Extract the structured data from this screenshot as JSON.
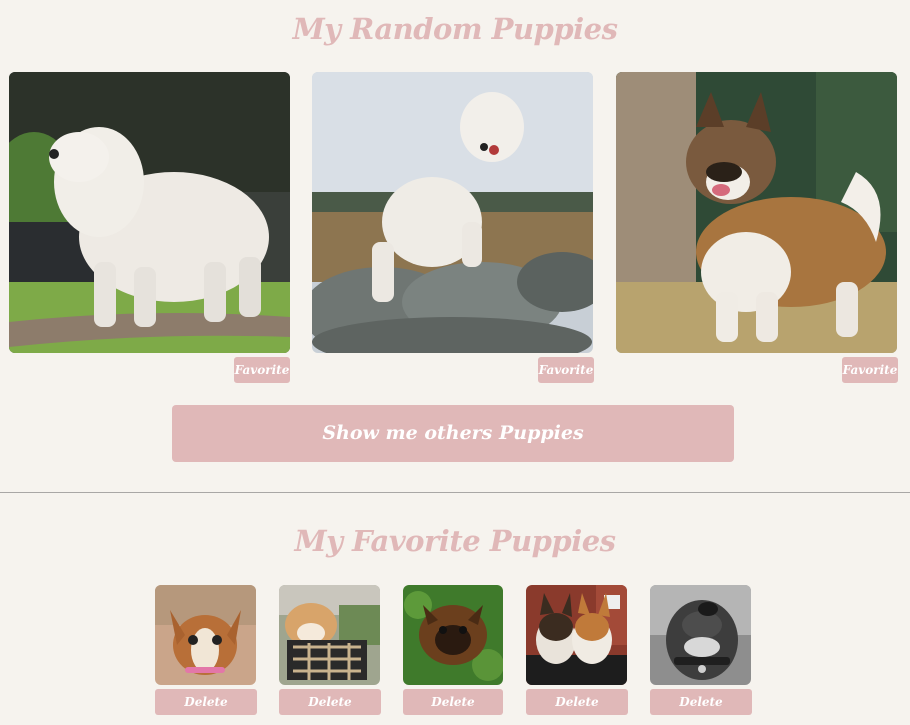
{
  "random": {
    "title": "My Random Puppies",
    "photos": [
      {
        "icon": "great-pyrenees-photo",
        "favorite_label": "Favorite"
      },
      {
        "icon": "white-puppy-on-rocks-photo",
        "favorite_label": "Favorite"
      },
      {
        "icon": "akita-photo",
        "favorite_label": "Favorite"
      }
    ],
    "show_more_label": "Show me others Puppies"
  },
  "favorites": {
    "title": "My Favorite Puppies",
    "photos": [
      {
        "icon": "chihuahua-puppy-photo",
        "delete_label": "Delete"
      },
      {
        "icon": "shiba-in-basket-photo",
        "delete_label": "Delete"
      },
      {
        "icon": "shepherd-puppy-in-grass-photo",
        "delete_label": "Delete"
      },
      {
        "icon": "two-corgis-photo",
        "delete_label": "Delete"
      },
      {
        "icon": "grayscale-pitbull-photo",
        "delete_label": "Delete"
      }
    ]
  },
  "colors": {
    "background": "#f6f3ee",
    "accent": "#e0b8b8",
    "button_text": "#ffffff"
  }
}
